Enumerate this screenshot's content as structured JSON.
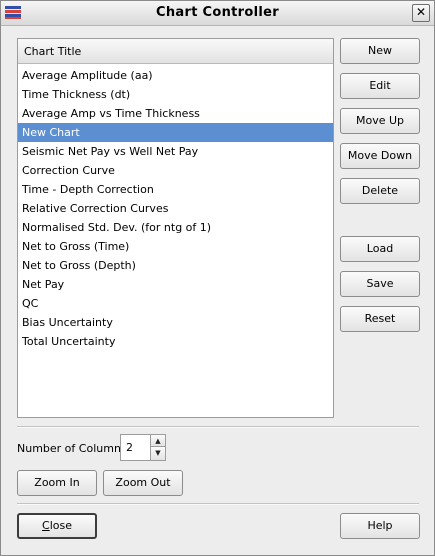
{
  "window": {
    "title": "Chart Controller",
    "close_glyph": "✕"
  },
  "list": {
    "header": "Chart Title",
    "selected_index": 3,
    "items": [
      "Average Amplitude (aa)",
      "Time Thickness (dt)",
      "Average Amp vs Time Thickness",
      "New Chart",
      "Seismic Net Pay vs Well Net Pay",
      "Correction Curve",
      "Time - Depth Correction",
      "Relative Correction Curves",
      "Normalised Std. Dev. (for ntg of 1)",
      "Net to Gross (Time)",
      "Net to Gross (Depth)",
      "Net Pay",
      "QC",
      "Bias Uncertainty",
      "Total Uncertainty"
    ]
  },
  "buttons": {
    "new": "New",
    "edit": "Edit",
    "move_up": "Move Up",
    "move_down": "Move Down",
    "delete": "Delete",
    "load": "Load",
    "save": "Save",
    "reset": "Reset",
    "zoom_in": "Zoom In",
    "zoom_out": "Zoom Out",
    "close_first": "C",
    "close_rest": "lose",
    "help": "Help"
  },
  "columns": {
    "label": "Number of Columns",
    "value": "2"
  },
  "icons": {
    "app": "flag-icon",
    "spin_up": "▲",
    "spin_down": "▼"
  }
}
